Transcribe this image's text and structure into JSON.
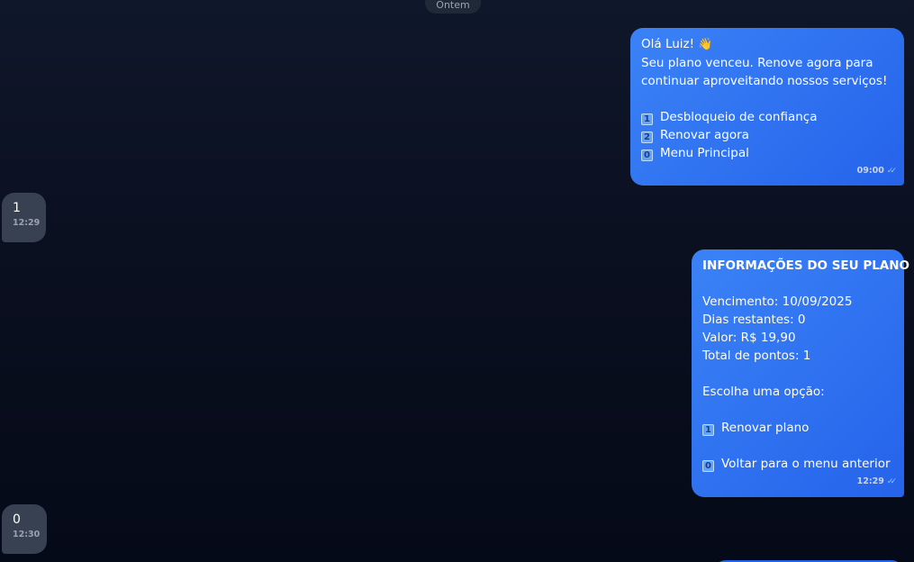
{
  "date_separator": "Ontem",
  "messages": [
    {
      "direction": "outgoing",
      "lines": [
        {
          "text": "Olá Luiz! ",
          "emoji": "👋"
        },
        {
          "text": "Seu plano venceu. Renove agora para"
        },
        {
          "text": "continuar aproveitando nossos serviços!"
        },
        {
          "text": ""
        },
        {
          "key": "1",
          "text": "Desbloqueio de confiança"
        },
        {
          "key": "2",
          "text": "Renovar agora"
        },
        {
          "key": "0",
          "text": "Menu Principal"
        }
      ],
      "time": "09:00",
      "status": "read"
    },
    {
      "direction": "incoming",
      "text": "1",
      "time": "12:29"
    },
    {
      "direction": "outgoing",
      "lines": [
        {
          "text": "INFORMAÇÕES DO SEU PLANO",
          "bold": true
        },
        {
          "text": ""
        },
        {
          "text": "Vencimento: 10/09/2025"
        },
        {
          "text": "Dias restantes: 0"
        },
        {
          "text": "Valor: R$ 19,90"
        },
        {
          "text": "Total de pontos: 1"
        },
        {
          "text": ""
        },
        {
          "text": "Escolha uma opção:"
        },
        {
          "text": ""
        },
        {
          "key": "1",
          "text": "Renovar plano"
        },
        {
          "text": ""
        },
        {
          "key": "0",
          "text": "Voltar para o menu anterior"
        }
      ],
      "time": "12:29",
      "status": "read"
    },
    {
      "direction": "incoming",
      "text": "0",
      "time": "12:30"
    }
  ],
  "colors": {
    "outgoing_bubble": "#2563eb",
    "incoming_bubble": "#374151",
    "background": "#0a0f1f"
  }
}
